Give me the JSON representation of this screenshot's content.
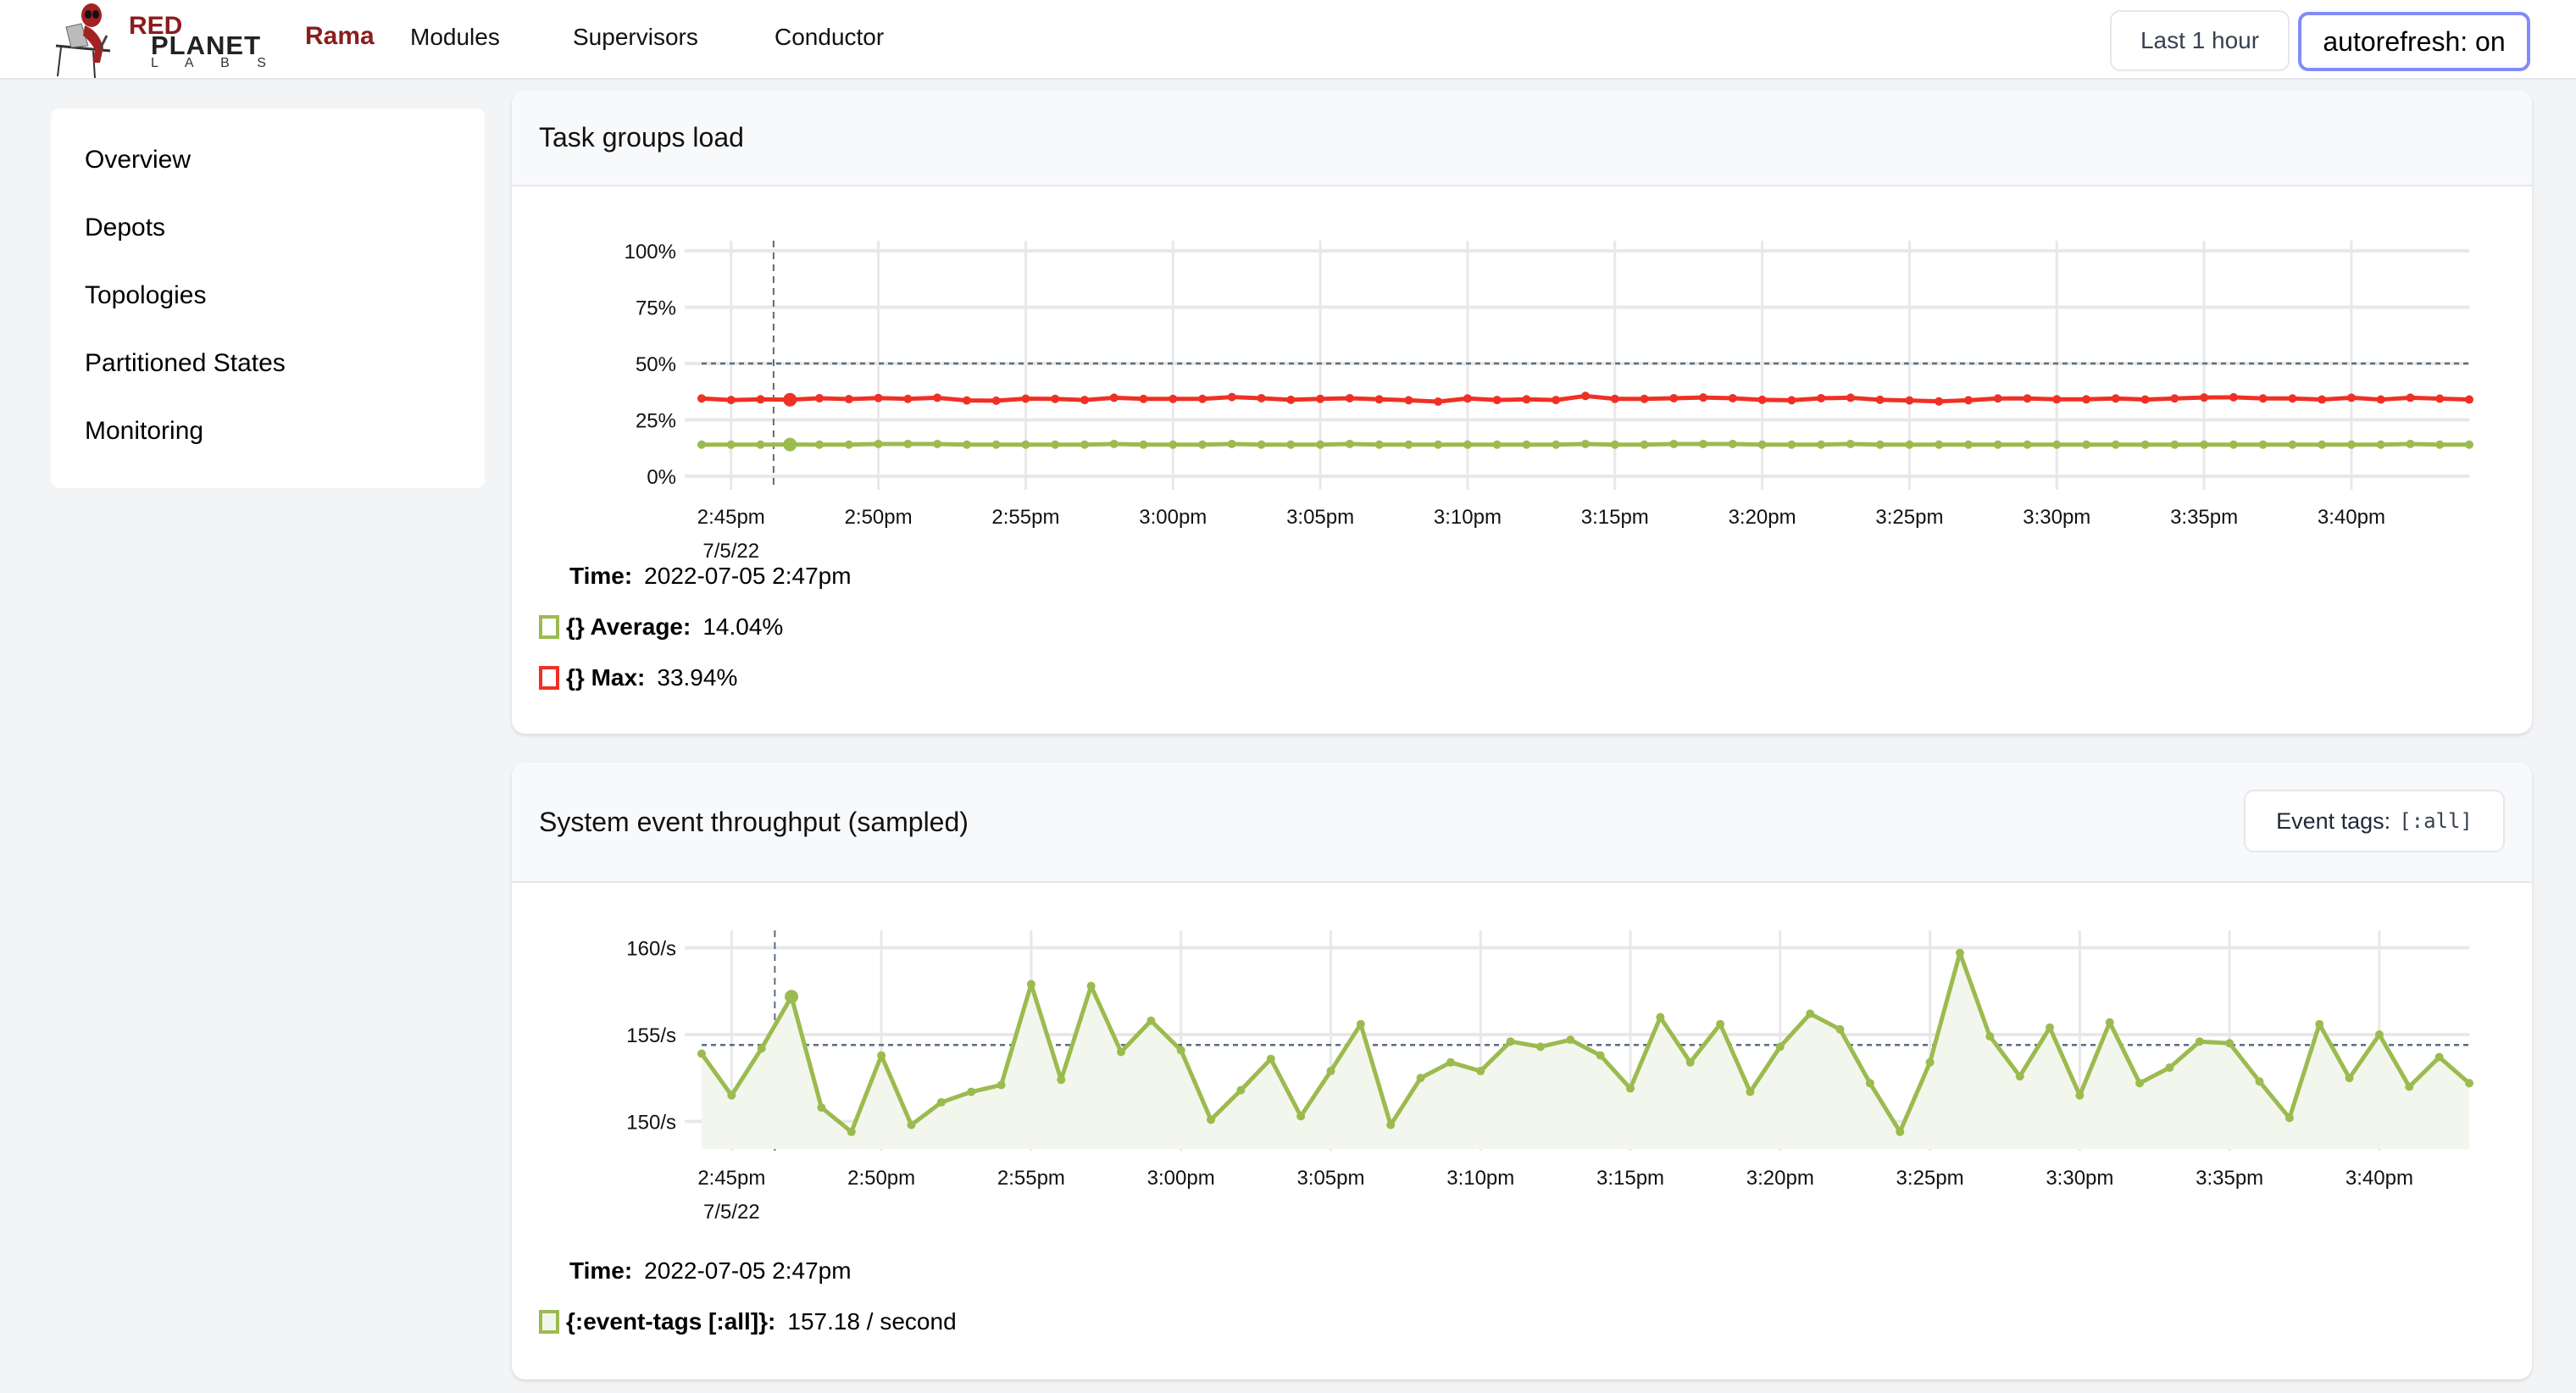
{
  "header": {
    "brand_top": "RED",
    "brand_mid": "PLANET",
    "brand_bottom": "L A B S",
    "app_name": "Rama",
    "nav": [
      {
        "label": "Modules"
      },
      {
        "label": "Supervisors"
      },
      {
        "label": "Conductor"
      }
    ],
    "time_range_label": "Last 1 hour",
    "autorefresh_label": "autorefresh: on"
  },
  "sidebar": {
    "items": [
      {
        "label": "Overview"
      },
      {
        "label": "Depots"
      },
      {
        "label": "Topologies"
      },
      {
        "label": "Partitioned States"
      },
      {
        "label": "Monitoring"
      }
    ]
  },
  "colors": {
    "average": "#9bbb4f",
    "max": "#ee3124",
    "throughput": "#9bbb4f",
    "accent_border": "#818cf8",
    "brand": "#8b1d1d"
  },
  "load_panel": {
    "title": "Task groups load",
    "hover": {
      "time_label": "Time:",
      "time_value": "2022-07-05 2:47pm",
      "series": [
        {
          "label": "{} Average:",
          "value": "14.04%",
          "color": "#9bbb4f"
        },
        {
          "label": "{} Max:",
          "value": "33.94%",
          "color": "#ee3124"
        }
      ]
    }
  },
  "throughput_panel": {
    "title": "System event throughput (sampled)",
    "event_tags_label": "Event tags:",
    "event_tags_value": "[:all]",
    "hover": {
      "time_label": "Time:",
      "time_value": "2022-07-05 2:47pm",
      "series": [
        {
          "label": "{:event-tags [:all]}:",
          "value": "157.18 / second",
          "color": "#9bbb4f"
        }
      ]
    }
  },
  "chart_data": [
    {
      "type": "line",
      "title": "Task groups load",
      "xlabel": "",
      "ylabel": "",
      "x_start": "2:44pm",
      "x_step_minutes": 1,
      "x_ticks": [
        "2:45pm",
        "2:50pm",
        "2:55pm",
        "3:00pm",
        "3:05pm",
        "3:10pm",
        "3:15pm",
        "3:20pm",
        "3:25pm",
        "3:30pm",
        "3:35pm",
        "3:40pm"
      ],
      "x_tick_minutes": [
        1,
        6,
        11,
        16,
        21,
        26,
        31,
        36,
        41,
        46,
        51,
        56
      ],
      "x_subtick": "7/5/22",
      "y_ticks": [
        "0%",
        "25%",
        "50%",
        "75%",
        "100%"
      ],
      "y_tick_values": [
        0,
        25,
        50,
        75,
        100
      ],
      "ylim": [
        0,
        100
      ],
      "grid": true,
      "threshold": 50,
      "hover_index": 3,
      "series": [
        {
          "name": "{} Max",
          "color": "#ee3124",
          "values": [
            34.5,
            33.8,
            34.1,
            33.94,
            34.6,
            34.2,
            34.7,
            34.3,
            34.8,
            33.6,
            33.5,
            34.4,
            34.3,
            33.8,
            34.8,
            34.3,
            34.3,
            34.3,
            35.1,
            34.6,
            33.9,
            34.3,
            34.6,
            34.1,
            33.7,
            33.1,
            34.5,
            33.8,
            34.1,
            33.8,
            35.6,
            34.3,
            34.3,
            34.6,
            34.9,
            34.6,
            33.9,
            33.7,
            34.6,
            34.8,
            33.9,
            33.6,
            33.2,
            33.7,
            34.5,
            34.5,
            34.1,
            34.1,
            34.5,
            34.0,
            34.5,
            34.9,
            35.0,
            34.5,
            34.5,
            34.0,
            34.8,
            34.0,
            34.8,
            34.4,
            34.0
          ]
        },
        {
          "name": "{} Average",
          "color": "#9bbb4f",
          "values": [
            14.0,
            14.0,
            14.0,
            14.04,
            14.0,
            14.0,
            14.3,
            14.3,
            14.3,
            14.0,
            14.0,
            14.0,
            14.0,
            14.0,
            14.3,
            14.0,
            14.0,
            14.0,
            14.3,
            14.0,
            14.0,
            14.0,
            14.3,
            14.0,
            14.0,
            14.0,
            14.0,
            14.0,
            14.0,
            14.0,
            14.3,
            14.0,
            14.0,
            14.3,
            14.3,
            14.3,
            14.0,
            14.0,
            14.0,
            14.3,
            14.0,
            14.0,
            14.0,
            14.0,
            14.0,
            14.0,
            14.0,
            14.0,
            14.0,
            14.0,
            14.0,
            14.0,
            14.0,
            14.0,
            14.0,
            14.0,
            14.0,
            14.0,
            14.3,
            14.0,
            14.0
          ]
        }
      ]
    },
    {
      "type": "area",
      "title": "System event throughput (sampled)",
      "xlabel": "",
      "ylabel": "",
      "x_start": "2:44pm",
      "x_step_minutes": 1,
      "x_ticks": [
        "2:45pm",
        "2:50pm",
        "2:55pm",
        "3:00pm",
        "3:05pm",
        "3:10pm",
        "3:15pm",
        "3:20pm",
        "3:25pm",
        "3:30pm",
        "3:35pm",
        "3:40pm"
      ],
      "x_tick_minutes": [
        1,
        6,
        11,
        16,
        21,
        26,
        31,
        36,
        41,
        46,
        51,
        56
      ],
      "x_subtick": "7/5/22",
      "y_ticks": [
        "150/s",
        "155/s",
        "160/s"
      ],
      "y_tick_values": [
        150,
        155,
        160
      ],
      "ylim": [
        148,
        161
      ],
      "grid": true,
      "threshold": 154.4,
      "hover_index": 3,
      "series": [
        {
          "name": "{:event-tags [:all]}",
          "color": "#9bbb4f",
          "values": [
            153.9,
            151.5,
            154.2,
            157.18,
            150.8,
            149.4,
            153.8,
            149.8,
            151.1,
            151.7,
            152.1,
            157.9,
            152.4,
            157.8,
            154.0,
            155.8,
            154.1,
            150.1,
            151.8,
            153.6,
            150.3,
            152.9,
            155.6,
            149.8,
            152.5,
            153.4,
            152.9,
            154.6,
            154.3,
            154.7,
            153.8,
            151.9,
            156.0,
            153.4,
            155.6,
            151.7,
            154.3,
            156.2,
            155.3,
            152.2,
            149.4,
            153.4,
            159.7,
            154.9,
            152.6,
            155.4,
            151.5,
            155.7,
            152.2,
            153.1,
            154.6,
            154.5,
            152.3,
            150.2,
            155.6,
            152.5,
            155.0,
            152.0,
            153.7,
            152.2
          ]
        }
      ]
    }
  ]
}
